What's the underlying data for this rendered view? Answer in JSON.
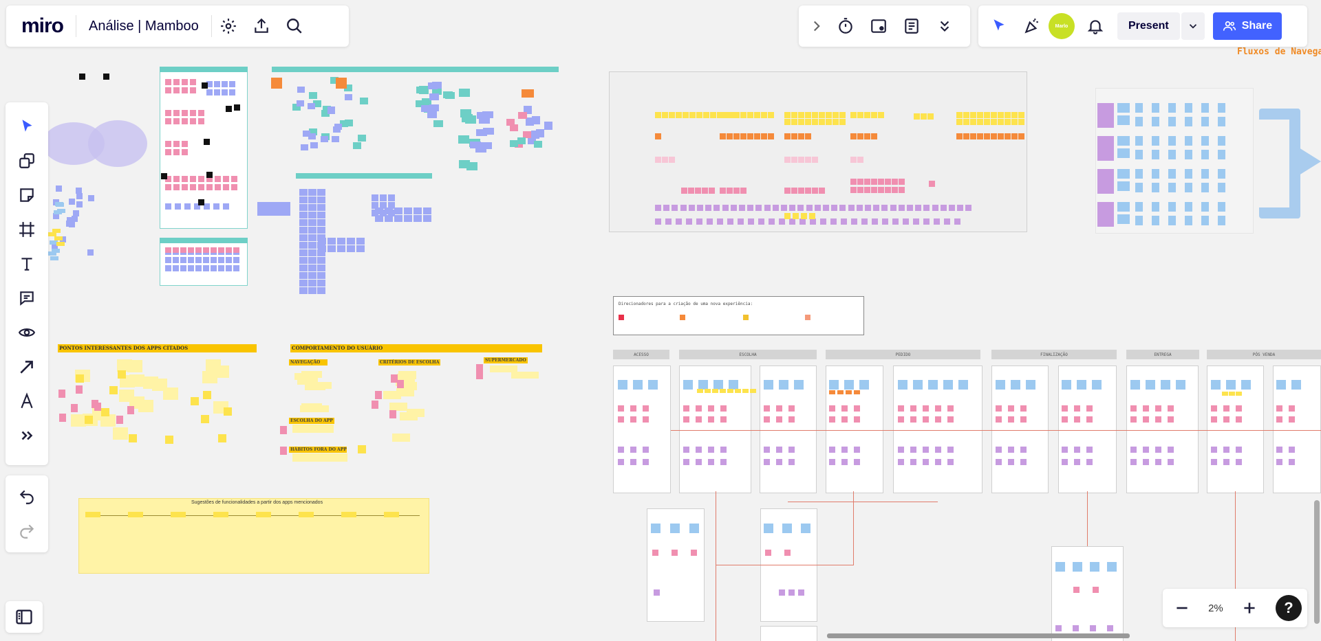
{
  "app": {
    "logo": "miro",
    "board_title": "Análise | Mamboo"
  },
  "top_right": {
    "present_label": "Present",
    "share_label": "Share",
    "avatar_text": "Marlo"
  },
  "zoom": {
    "value": "2%"
  },
  "canvas": {
    "flows_label": "Fluxos de Navega",
    "section_titles": {
      "pontos": "PONTOS INTERESSANTES DOS APPS CITADOS",
      "comportamento": "COMPORTAMENTO DO USUÁRIO",
      "navegacao": "NAVEGAÇÃO",
      "criterios": "CRITÉRIOS DE ESCOLHA",
      "supermercado": "SUPERMERCADO",
      "escolha_app": "ESCOLHA DO APP",
      "habitos": "HÁBITOS FORA DO APP",
      "sugestoes": "Sugestões de funcionalidades a partir dos apps mencionados",
      "direcionadores": "Direcionadores para a criação de uma nova experiência:"
    },
    "journey_stages": [
      "ACESSO",
      "ESCOLHA",
      "PEDIDO",
      "FINALIZAÇÃO",
      "ENTREGA",
      "PÓS VENDA"
    ]
  },
  "colors": {
    "accent": "#4262ff",
    "sticky_purple": "#9ea8f5",
    "sticky_pink": "#f08fb0",
    "sticky_yellow": "#fde34d",
    "sticky_orange": "#f58a3a",
    "sticky_teal": "#6dcfc6",
    "sticky_blue": "#9cc9f0",
    "sticky_violet": "#c79be0"
  }
}
